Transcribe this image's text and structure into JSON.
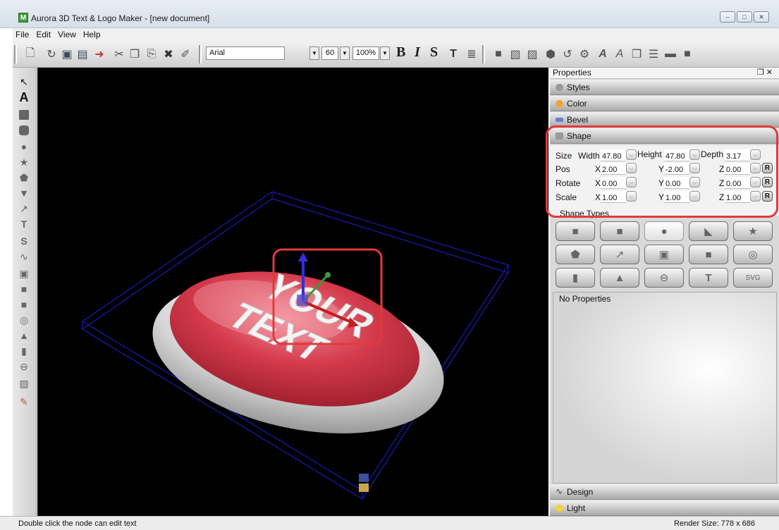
{
  "window": {
    "title": "Aurora 3D Text & Logo Maker - [new document]",
    "app_icon": "M",
    "controls": [
      "minimize-icon",
      "maximize-icon",
      "close-icon"
    ]
  },
  "menu": [
    "File",
    "Edit",
    "View",
    "Help"
  ],
  "toolbar": {
    "font": "Arial",
    "size": "60",
    "zoom": "100%",
    "bold": "B",
    "italic": "I",
    "shadow": "S"
  },
  "viewport": {
    "text_line1": "YOUR",
    "text_line2": "TEXT",
    "button_color": "#d43a4b"
  },
  "properties": {
    "title": "Properties",
    "sections_top": [
      "Styles",
      "Color",
      "Bevel",
      "Shape"
    ],
    "sections_bottom": [
      "Design",
      "Light"
    ],
    "shape": {
      "size_label": "Size",
      "width_label": "Width",
      "height_label": "Height",
      "depth_label": "Depth",
      "width": "47.80",
      "height": "47.80",
      "depth": "3.17",
      "pos_label": "Pos",
      "pos": {
        "x": "2.00",
        "y": "-2.00",
        "z": "0.00"
      },
      "rotate_label": "Rotate",
      "rotate": {
        "x": "0.00",
        "y": "0.00",
        "z": "0.00"
      },
      "scale_label": "Scale",
      "scale": {
        "x": "1.00",
        "y": "1.00",
        "z": "1.00"
      },
      "x": "X",
      "y": "Y",
      "z": "Z",
      "r": "R"
    },
    "shape_types_label": "Shape Types",
    "shape_types": [
      "square-icon",
      "rounded-square-icon",
      "circle-icon",
      "rounded-corner-icon",
      "star-icon",
      "pentagon-icon",
      "arrow-icon",
      "bevel-box-icon",
      "rounded-box-icon",
      "ring-icon",
      "cylinder-icon",
      "cone-icon",
      "torus-icon",
      "text-icon",
      "svg-icon"
    ],
    "svg_label": "SVG",
    "no_properties": "No Properties"
  },
  "status": {
    "left": "Double click the node can edit text",
    "right": "Render Size: 778 x 686"
  }
}
